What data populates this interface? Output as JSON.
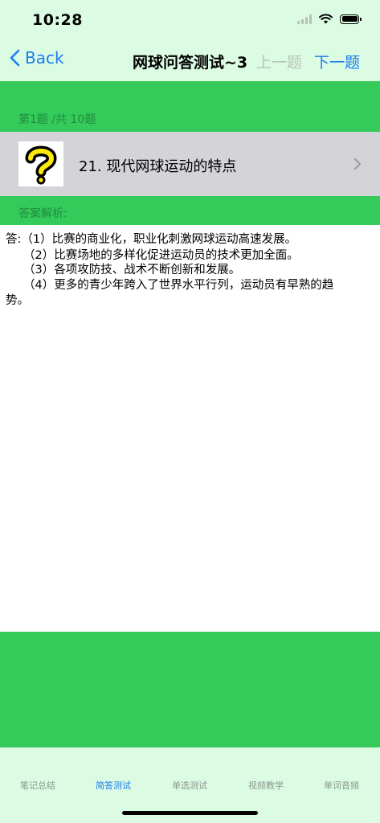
{
  "status_bar": {
    "time": "10:28"
  },
  "nav": {
    "back_label": "Back",
    "title": "网球问答测试~3",
    "prev_label": "上一题",
    "next_label": "下一题"
  },
  "question": {
    "counter": "第1题 /共 10题",
    "text": "21.  现代网球运动的特点",
    "icon": "question-mark-icon"
  },
  "answer": {
    "label": "答案解析:",
    "lines": [
      "答:（1）比赛的商业化，职业化刺激网球运动高速发展。",
      "（2）比赛场地的多样化促进运动员的技术更加全面。",
      "（3）各项攻防技、战术不断创新和发展。",
      "（4）更多的青少年跨入了世界水平行列，运动员有早熟的趋",
      "势。"
    ]
  },
  "tabs": [
    {
      "label": "笔记总结",
      "active": false
    },
    {
      "label": "简答测试",
      "active": true
    },
    {
      "label": "单选测试",
      "active": false
    },
    {
      "label": "视频教学",
      "active": false
    },
    {
      "label": "单词音频",
      "active": false
    }
  ],
  "colors": {
    "accent": "#1e7cf2",
    "green": "#35cb5b",
    "background": "#dbfbe3",
    "disabled": "#b7c3bb"
  }
}
